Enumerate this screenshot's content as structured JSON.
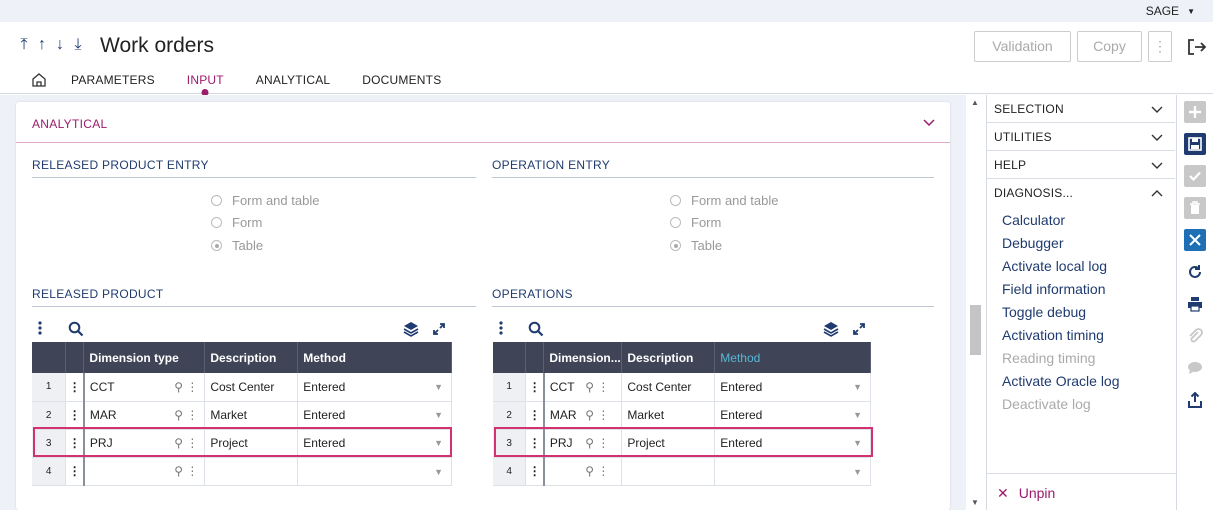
{
  "user": {
    "name": "SAGE"
  },
  "header": {
    "title": "Work orders",
    "validation_label": "Validation",
    "copy_label": "Copy"
  },
  "tabs": [
    {
      "label": "PARAMETERS"
    },
    {
      "label": "INPUT"
    },
    {
      "label": "ANALYTICAL"
    },
    {
      "label": "DOCUMENTS"
    }
  ],
  "section": {
    "title": "ANALYTICAL"
  },
  "released_entry": {
    "title": "RELEASED PRODUCT ENTRY",
    "options": [
      "Form and table",
      "Form",
      "Table"
    ],
    "selected": "Table"
  },
  "operation_entry": {
    "title": "OPERATION ENTRY",
    "options": [
      "Form and table",
      "Form",
      "Table"
    ],
    "selected": "Table"
  },
  "released_product": {
    "title": "RELEASED PRODUCT",
    "columns": [
      "Dimension type",
      "Description",
      "Method"
    ],
    "rows": [
      {
        "num": "1",
        "dim": "CCT",
        "desc": "Cost Center",
        "method": "Entered"
      },
      {
        "num": "2",
        "dim": "MAR",
        "desc": "Market",
        "method": "Entered"
      },
      {
        "num": "3",
        "dim": "PRJ",
        "desc": "Project",
        "method": "Entered"
      },
      {
        "num": "4",
        "dim": "",
        "desc": "",
        "method": ""
      }
    ]
  },
  "operations": {
    "title": "OPERATIONS",
    "columns": [
      "Dimension...",
      "Description",
      "Method"
    ],
    "rows": [
      {
        "num": "1",
        "dim": "CCT",
        "desc": "Cost Center",
        "method": "Entered"
      },
      {
        "num": "2",
        "dim": "MAR",
        "desc": "Market",
        "method": "Entered"
      },
      {
        "num": "3",
        "dim": "PRJ",
        "desc": "Project",
        "method": "Entered"
      },
      {
        "num": "4",
        "dim": "",
        "desc": "",
        "method": ""
      }
    ]
  },
  "sidebar": {
    "selection": "SELECTION",
    "utilities": "UTILITIES",
    "help": "HELP",
    "diagnosis": "DIAGNOSIS...",
    "diagnosis_items": [
      {
        "label": "Calculator",
        "enabled": true
      },
      {
        "label": "Debugger",
        "enabled": true
      },
      {
        "label": "Activate local log",
        "enabled": true
      },
      {
        "label": "Field information",
        "enabled": true
      },
      {
        "label": "Toggle debug",
        "enabled": true
      },
      {
        "label": "Activation timing",
        "enabled": true
      },
      {
        "label": "Reading timing",
        "enabled": false
      },
      {
        "label": "Activate Oracle log",
        "enabled": true
      },
      {
        "label": "Deactivate log",
        "enabled": false
      }
    ],
    "unpin": "Unpin"
  },
  "colors": {
    "accent": "#9b1b6c",
    "navy": "#1f3b6f",
    "grid_header": "#3f4556",
    "highlight": "#d2326f"
  }
}
